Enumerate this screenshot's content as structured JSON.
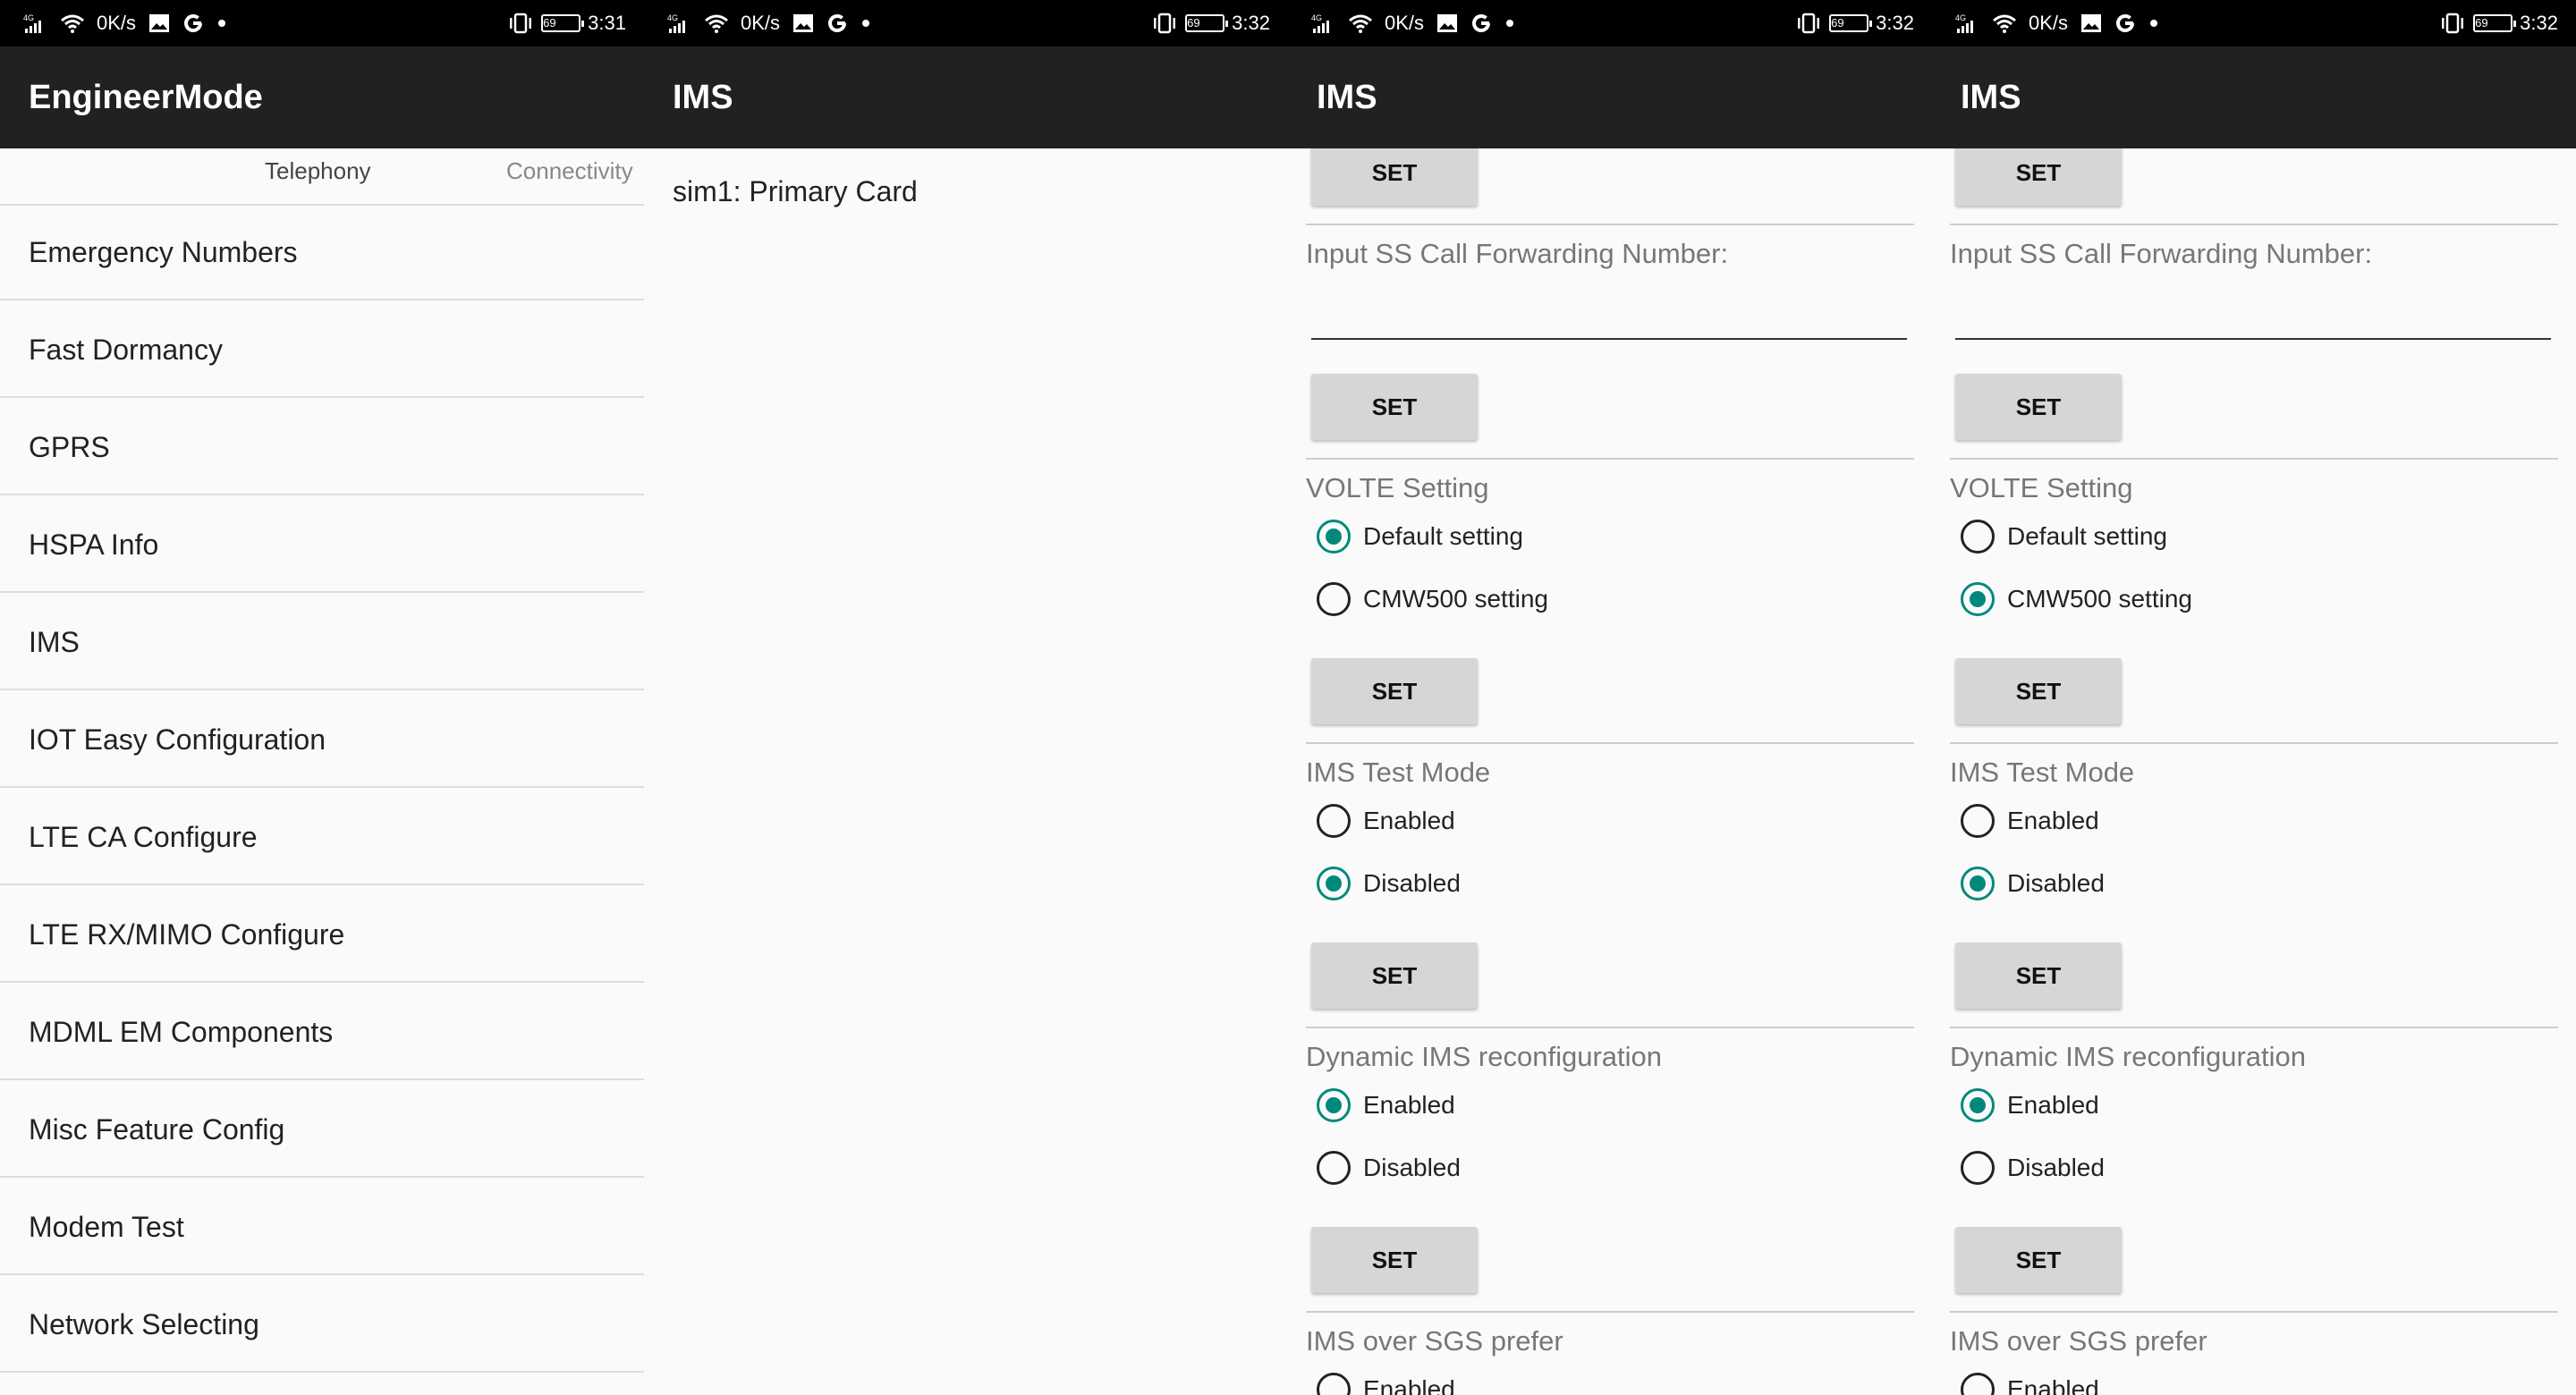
{
  "panels": [
    {
      "status": {
        "network": "4G",
        "speed": "0K/s",
        "battery": "69",
        "time": "3:31"
      },
      "title": "EngineerMode",
      "tabs": [
        "Telephony",
        "Connectivity"
      ],
      "items": [
        "Emergency Numbers",
        "Fast Dormancy",
        "GPRS",
        "HSPA Info",
        "IMS",
        "IOT Easy Configuration",
        "LTE CA Configure",
        "LTE RX/MIMO Configure",
        "MDML EM Components",
        "Misc Feature Config",
        "Modem Test",
        "Network Selecting"
      ]
    },
    {
      "status": {
        "network": "4G",
        "speed": "0K/s",
        "battery": "69",
        "time": "3:32"
      },
      "title": "IMS",
      "sim": "sim1: Primary Card"
    },
    {
      "status": {
        "network": "4G",
        "speed": "0K/s",
        "battery": "69",
        "time": "3:32"
      },
      "title": "IMS",
      "set_label": "SET",
      "forwarding_label": "Input SS Call Forwarding Number:",
      "volte": {
        "label": "VOLTE Setting",
        "options": [
          "Default setting",
          "CMW500 setting"
        ],
        "selected": "Default setting"
      },
      "test_mode": {
        "label": "IMS Test Mode",
        "options": [
          "Enabled",
          "Disabled"
        ],
        "selected": "Disabled"
      },
      "dynamic": {
        "label": "Dynamic IMS reconfiguration",
        "options": [
          "Enabled",
          "Disabled"
        ],
        "selected": "Enabled"
      },
      "sgs": {
        "label": "IMS over SGS prefer",
        "options": [
          "Enabled"
        ]
      }
    },
    {
      "status": {
        "network": "4G",
        "speed": "0K/s",
        "battery": "69",
        "time": "3:32"
      },
      "title": "IMS",
      "set_label": "SET",
      "forwarding_label": "Input SS Call Forwarding Number:",
      "volte": {
        "label": "VOLTE Setting",
        "options": [
          "Default setting",
          "CMW500 setting"
        ],
        "selected": "CMW500 setting"
      },
      "test_mode": {
        "label": "IMS Test Mode",
        "options": [
          "Enabled",
          "Disabled"
        ],
        "selected": "Disabled"
      },
      "dynamic": {
        "label": "Dynamic IMS reconfiguration",
        "options": [
          "Enabled",
          "Disabled"
        ],
        "selected": "Enabled"
      },
      "sgs": {
        "label": "IMS over SGS prefer",
        "options": [
          "Enabled"
        ]
      }
    }
  ],
  "icons": {
    "status_left": [
      "signal-4g-icon",
      "wifi-icon",
      "image-icon",
      "google-icon",
      "dot-icon"
    ],
    "status_right": [
      "vibrate-icon",
      "battery-icon"
    ]
  },
  "colors": {
    "accent": "#00897b",
    "appbar": "#212121",
    "statusbar": "#000000",
    "button": "#d6d6d6"
  }
}
